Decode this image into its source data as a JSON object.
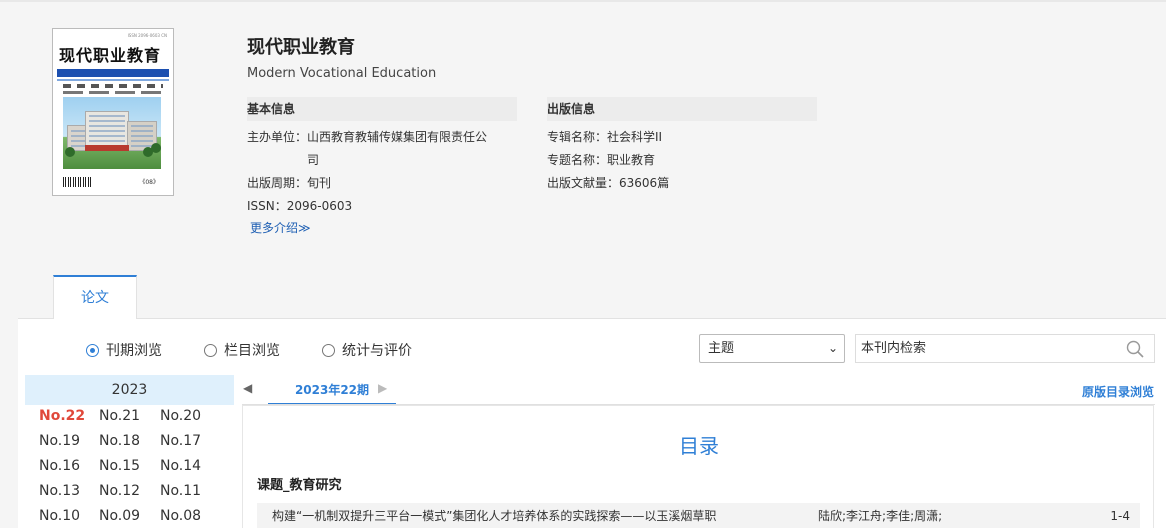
{
  "journal": {
    "title": "现代职业教育",
    "title_en": "Modern Vocational Education"
  },
  "cover": {
    "title": "现代职业教育",
    "issue_mark": "《08》"
  },
  "basic_info": {
    "heading": "基本信息",
    "sponsor_label": "主办单位：",
    "sponsor_value_line1": "山西教育教辅传媒集团有限责任公",
    "sponsor_value_line2": "司",
    "cycle_label": "出版周期：",
    "cycle_value": "旬刊",
    "issn_label": "ISSN：",
    "issn_value": "2096-0603",
    "more_label": "更多介绍≫"
  },
  "publish_info": {
    "heading": "出版信息",
    "album_label": "专辑名称：",
    "album_value": "社会科学II",
    "topic_label": "专题名称：",
    "topic_value": "职业教育",
    "count_label": "出版文献量：",
    "count_value": "63606篇"
  },
  "tabs": {
    "paper": "论文"
  },
  "browse_modes": [
    {
      "label": "刊期浏览",
      "selected": true
    },
    {
      "label": "栏目浏览",
      "selected": false
    },
    {
      "label": "统计与评价",
      "selected": false
    }
  ],
  "search": {
    "field_selected": "主题",
    "placeholder": "本刊内检索"
  },
  "issues": {
    "year": "2023",
    "list": [
      "No.22",
      "No.21",
      "No.20",
      "No.19",
      "No.18",
      "No.17",
      "No.16",
      "No.15",
      "No.14",
      "No.13",
      "No.12",
      "No.11",
      "No.10",
      "No.09",
      "No.08"
    ],
    "active": "No.22"
  },
  "issue_nav": {
    "prev": "◀",
    "next": "▶",
    "current": "2023年22期",
    "original_toc": "原版目录浏览"
  },
  "toc": {
    "title": "目录",
    "column": "课题_教育研究",
    "rows": [
      {
        "title": "构建“一机制双提升三平台一模式”集团化人才培养体系的实践探索——以玉溪烟草职",
        "authors": "陆欣;李江舟;李佳;周潇;",
        "pages": "1-4"
      }
    ]
  },
  "colors": {
    "accent": "#2f7fd6",
    "active_issue": "#e0483a",
    "year_bg": "#dff0fc"
  }
}
